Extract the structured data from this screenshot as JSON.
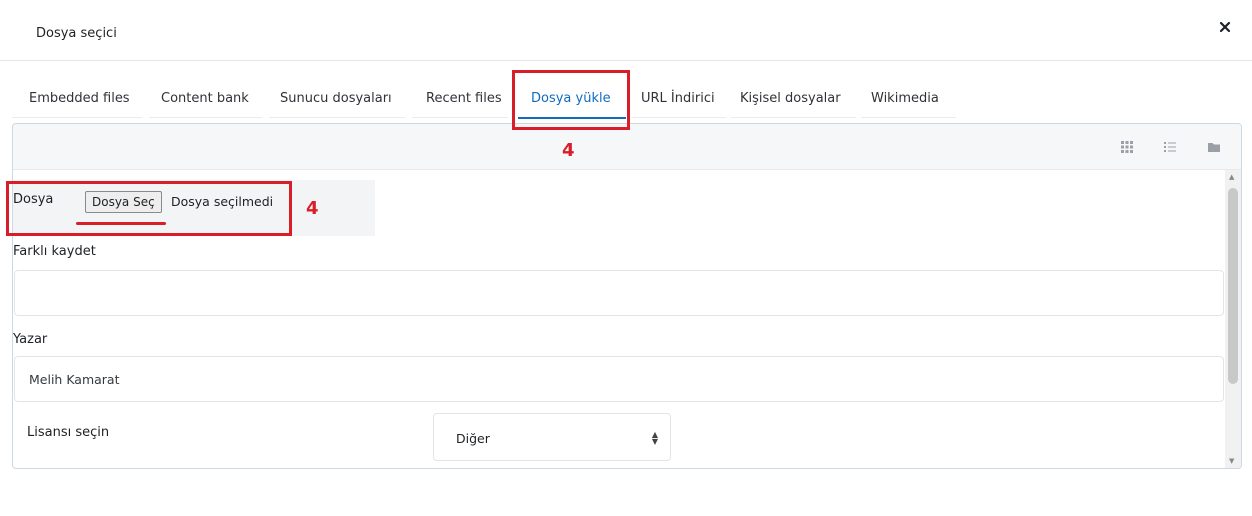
{
  "dialog": {
    "title": "Dosya seçici"
  },
  "tabs": [
    {
      "label": "Embedded files",
      "active": false
    },
    {
      "label": "Content bank",
      "active": false
    },
    {
      "label": "Sunucu dosyaları",
      "active": false
    },
    {
      "label": "Recent files",
      "active": false
    },
    {
      "label": "Dosya yükle",
      "active": true
    },
    {
      "label": "URL İndirici",
      "active": false
    },
    {
      "label": "Kişisel dosyalar",
      "active": false
    },
    {
      "label": "Wikimedia",
      "active": false
    }
  ],
  "view_buttons": [
    "grid-view-icon",
    "list-view-icon",
    "folder-view-icon"
  ],
  "form": {
    "file_label": "Dosya",
    "choose_button": "Dosya Seç",
    "no_file_text": "Dosya seçilmedi",
    "save_as_label": "Farklı kaydet",
    "save_as_value": "",
    "author_label": "Yazar",
    "author_value": "Melih Kamarat",
    "license_label": "Lisansı seçin",
    "license_value": "Diğer"
  },
  "annotations": {
    "step_number_tab": "4",
    "step_number_file": "4"
  },
  "colors": {
    "accent": "#0f6cbf",
    "annotation": "#d81e28"
  }
}
